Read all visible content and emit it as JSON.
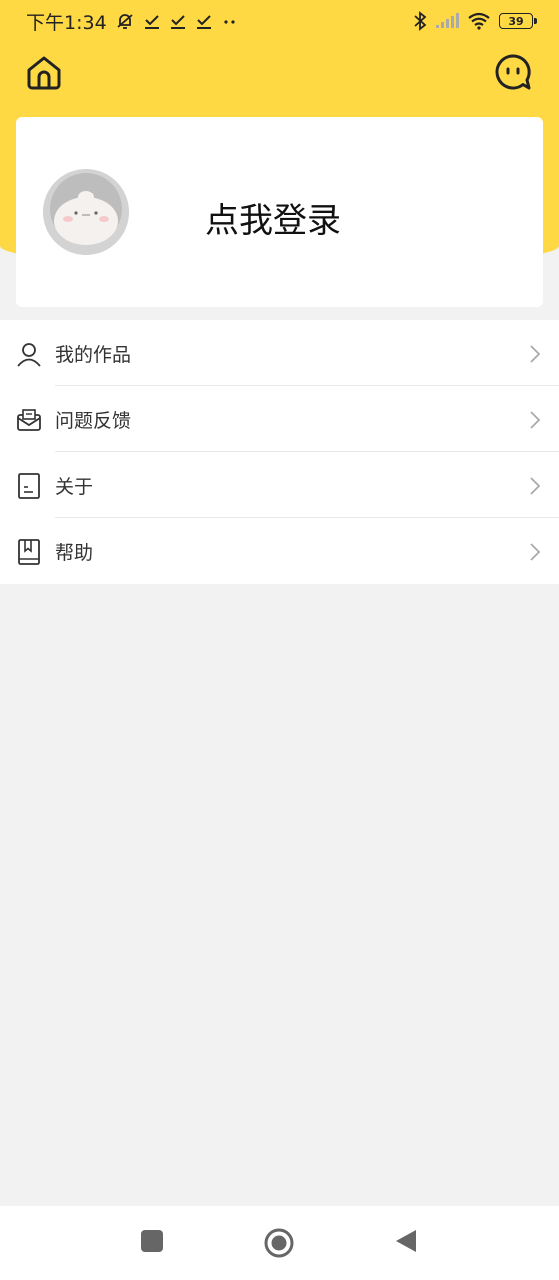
{
  "status_bar": {
    "time": "下午1:34",
    "battery": "39"
  },
  "header": {
    "home_icon": "home-icon",
    "chat_icon": "chat-bubble-icon"
  },
  "login_card": {
    "login_label": "点我登录",
    "avatar_icon": "robot-avatar"
  },
  "menu": {
    "items": [
      {
        "label": "我的作品",
        "icon": "user-icon"
      },
      {
        "label": "问题反馈",
        "icon": "mail-icon"
      },
      {
        "label": "关于",
        "icon": "document-icon"
      },
      {
        "label": "帮助",
        "icon": "book-icon"
      }
    ]
  },
  "colors": {
    "header_yellow": "#ffd944",
    "background": "#f2f2f2"
  }
}
